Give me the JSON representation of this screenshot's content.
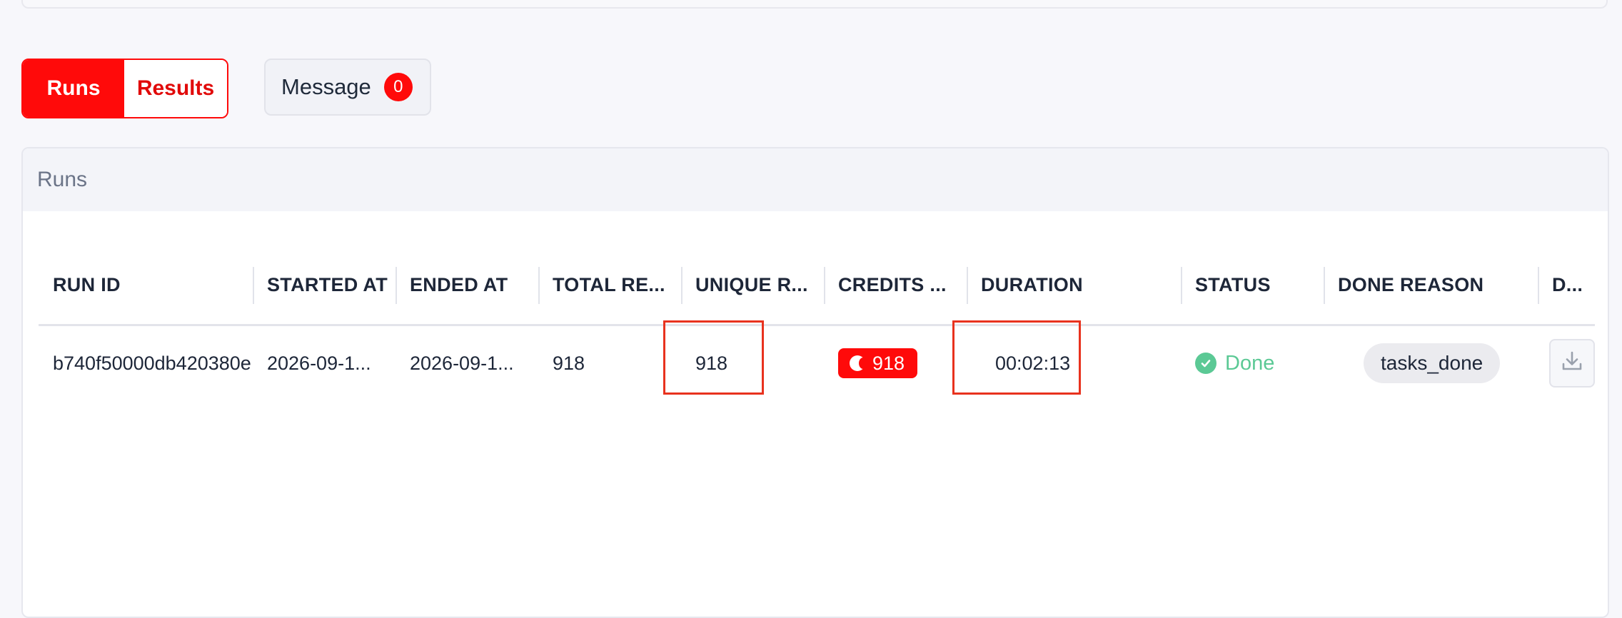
{
  "tabs": {
    "runs_label": "Runs",
    "results_label": "Results"
  },
  "message": {
    "label": "Message",
    "count": "0"
  },
  "runs_card": {
    "title": "Runs"
  },
  "table": {
    "columns": [
      "RUN ID",
      "STARTED AT",
      "ENDED AT",
      "TOTAL RE...",
      "UNIQUE R...",
      "CREDITS ...",
      "DURATION",
      "STATUS",
      "DONE REASON",
      "D..."
    ],
    "rows": [
      {
        "run_id": "b740f50000db420380e",
        "started_at": "2026-09-1...",
        "ended_at": "2026-09-1...",
        "total_results": "918",
        "unique_results": "918",
        "credits": "918",
        "duration": "00:02:13",
        "status": "Done",
        "done_reason": "tasks_done"
      }
    ]
  },
  "icons": {
    "credits": "coin-icon",
    "status": "check-circle-icon",
    "download": "download-icon"
  },
  "colors": {
    "accent": "#ff0a0a",
    "status_done": "#5bc995",
    "highlight": "#e8321e"
  }
}
